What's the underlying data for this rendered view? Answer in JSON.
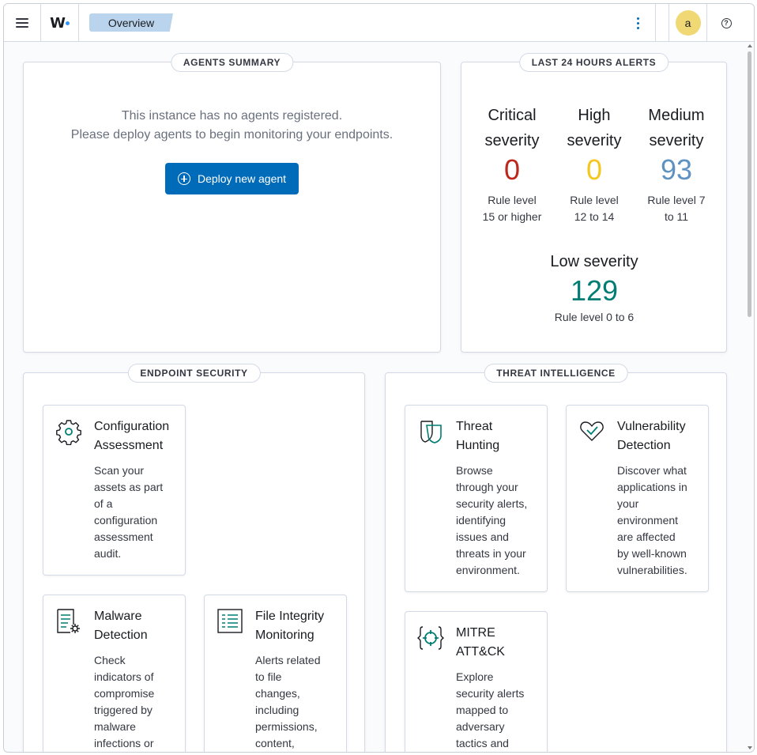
{
  "header": {
    "logo_text": "W.",
    "breadcrumb": "Overview",
    "avatar_initial": "a",
    "help_glyph": "?"
  },
  "agents_summary": {
    "title": "AGENTS SUMMARY",
    "message_line1": "This instance has no agents registered.",
    "message_line2": "Please deploy agents to begin monitoring your endpoints.",
    "deploy_label": "Deploy new agent"
  },
  "alerts": {
    "title": "LAST 24 HOURS ALERTS",
    "critical": {
      "name_line1": "Critical",
      "name_line2": "severity",
      "count": "0",
      "level_line1": "Rule level",
      "level_line2": "15 or higher",
      "color": "#bd271e"
    },
    "high": {
      "name_line1": "High",
      "name_line2": "severity",
      "count": "0",
      "level_line1": "Rule level",
      "level_line2": "12 to 14",
      "color": "#f5c61c"
    },
    "medium": {
      "name_line1": "Medium",
      "name_line2": "severity",
      "count": "93",
      "level_line1": "Rule level 7",
      "level_line2": "to 11",
      "color": "#6092c0"
    },
    "low": {
      "name": "Low severity",
      "count": "129",
      "level": "Rule level 0 to 6",
      "color": "#017d73"
    }
  },
  "endpoint_security": {
    "title": "ENDPOINT SECURITY",
    "modules": [
      {
        "icon": "gear-icon",
        "title_line1": "Configuration",
        "title_line2": "Assessment",
        "desc": [
          "Scan your",
          "assets as part",
          "of a",
          "configuration",
          "assessment",
          "audit."
        ]
      },
      {
        "icon": "document-gear-icon",
        "title_line1": "Malware",
        "title_line2": "Detection",
        "desc": [
          "Check",
          "indicators of",
          "compromise",
          "triggered by",
          "malware",
          "infections or"
        ]
      },
      {
        "icon": "list-document-icon",
        "title_line1": "File Integrity",
        "title_line2": "Monitoring",
        "desc": [
          "Alerts related",
          "to file",
          "changes,",
          "including",
          "permissions,",
          "content,"
        ]
      }
    ]
  },
  "threat_intelligence": {
    "title": "THREAT INTELLIGENCE",
    "modules": [
      {
        "icon": "shield-flag-icon",
        "title_line1": "Threat",
        "title_line2": "Hunting",
        "desc": [
          "Browse",
          "through your",
          "security alerts,",
          "identifying",
          "issues and",
          "threats in your",
          "environment."
        ]
      },
      {
        "icon": "heart-check-icon",
        "title_line1": "Vulnerability",
        "title_line2": "Detection",
        "desc": [
          "Discover what",
          "applications in",
          "your",
          "environment",
          "are affected",
          "by well-known",
          "vulnerabilities."
        ]
      },
      {
        "icon": "target-icon",
        "title_line1": "MITRE",
        "title_line2": "ATT&CK",
        "desc": [
          "Explore",
          "security alerts",
          "mapped to",
          "adversary",
          "tactics and"
        ]
      }
    ]
  },
  "colors": {
    "accent": "#006bb8",
    "icon_teal": "#017d73"
  }
}
